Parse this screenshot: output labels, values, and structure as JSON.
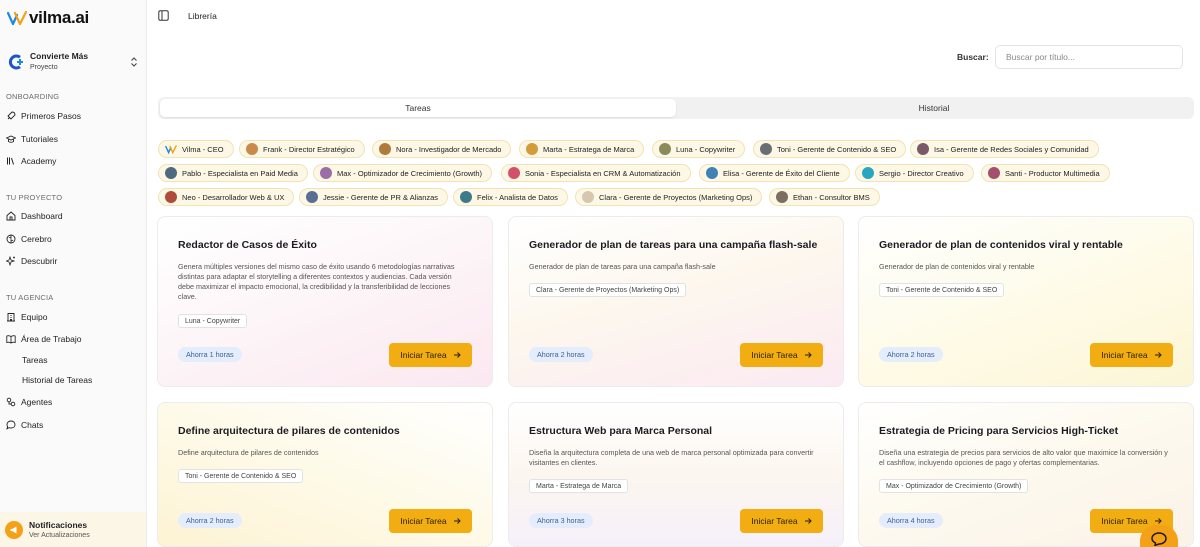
{
  "brand": {
    "name": "vilma.ai",
    "accent": "#f2ad12",
    "logo_blue": "#1976d2"
  },
  "project": {
    "name": "Convierte Más",
    "sub": "Proyecto"
  },
  "sidebar": {
    "onboarding_label": "ONBOARDING",
    "onboarding": [
      {
        "label": "Primeros Pasos",
        "icon": "rocket-icon"
      },
      {
        "label": "Tutoriales",
        "icon": "graduation-cap-icon"
      },
      {
        "label": "Academy",
        "icon": "library-icon"
      }
    ],
    "project_label": "TU PROYECTO",
    "project_items": [
      {
        "label": "Dashboard",
        "icon": "home-icon"
      },
      {
        "label": "Cerebro",
        "icon": "brain-icon"
      },
      {
        "label": "Descubrir",
        "icon": "sparkles-icon"
      }
    ],
    "agency_label": "TU AGENCIA",
    "agency_items": [
      {
        "label": "Equipo",
        "icon": "building-icon"
      },
      {
        "label": "Área de Trabajo",
        "icon": "book-open-icon"
      },
      {
        "label": "Tareas",
        "icon": ""
      },
      {
        "label": "Historial de Tareas",
        "icon": ""
      },
      {
        "label": "Agentes",
        "icon": "agents-icon"
      },
      {
        "label": "Chats",
        "icon": "chat-icon"
      }
    ],
    "notifications": {
      "title": "Notificaciones",
      "sub": "Ver Actualizaciones"
    }
  },
  "header": {
    "breadcrumb": "Librería"
  },
  "search": {
    "label": "Buscar:",
    "placeholder": "Buscar por título...",
    "value": ""
  },
  "tabs": [
    {
      "label": "Tareas",
      "active": true
    },
    {
      "label": "Historial",
      "active": false
    }
  ],
  "agents": [
    "Vilma - CEO",
    "Frank - Director Estratégico",
    "Nora - Investigador de Mercado",
    "Marta - Estratega de Marca",
    "Luna - Copywriter",
    "Toni - Gerente de Contenido & SEO",
    "Isa - Gerente de Redes Sociales y Comunidad",
    "Pablo - Especialista en Paid Media",
    "Max - Optimizador de Crecimiento (Growth)",
    "Sonia - Especialista en CRM & Automatización",
    "Elisa - Gerente de Éxito del Cliente",
    "Sergio - Director Creativo",
    "Santi - Productor Multimedia",
    "Neo - Desarrollador Web & UX",
    "Jessie - Gerente de PR & Alianzas",
    "Felix - Analista de Datos",
    "Clara - Gerente de Proyectos (Marketing Ops)",
    "Ethan - Consultor BMS"
  ],
  "start_label": "Iniciar Tarea",
  "cards": [
    {
      "title": "Redactor de Casos de Éxito",
      "desc": "Genera múltiples versiones del mismo caso de éxito usando 6 metodologías narrativas distintas para adaptar el storytelling a diferentes contextos y audiencias. Cada versión debe maximizar el impacto emocional, la credibilidad y la transferibilidad de lecciones clave.",
      "agent": "Luna - Copywriter",
      "time": "Ahorra 1 horas"
    },
    {
      "title": "Generador de plan de tareas para una campaña flash-sale",
      "desc": "Generador de plan de tareas para una campaña flash-sale",
      "agent": "Clara - Gerente de Proyectos (Marketing Ops)",
      "time": "Ahorra 2 horas"
    },
    {
      "title": "Generador de plan de contenidos viral y rentable",
      "desc": "Generador de plan de contenidos viral y rentable",
      "agent": "Toni - Gerente de Contenido & SEO",
      "time": "Ahorra 2 horas"
    },
    {
      "title": "Define arquitectura de pilares de contenidos",
      "desc": "Define arquitectura de pilares de contenidos",
      "agent": "Toni - Gerente de Contenido & SEO",
      "time": "Ahorra 2 horas"
    },
    {
      "title": "Estructura Web para Marca Personal",
      "desc": "Diseña la arquitectura completa de una web de marca personal optimizada para convertir visitantes en clientes.",
      "agent": "Marta - Estratega de Marca",
      "time": "Ahorra 3 horas"
    },
    {
      "title": "Estrategia de Pricing para Servicios High-Ticket",
      "desc": "Diseña una estrategia de precios para servicios de alto valor que maximice la conversión y el cashflow, incluyendo opciones de pago y ofertas complementarias.",
      "agent": "Max - Optimizador de Crecimiento (Growth)",
      "time": "Ahorra 4 horas"
    }
  ]
}
